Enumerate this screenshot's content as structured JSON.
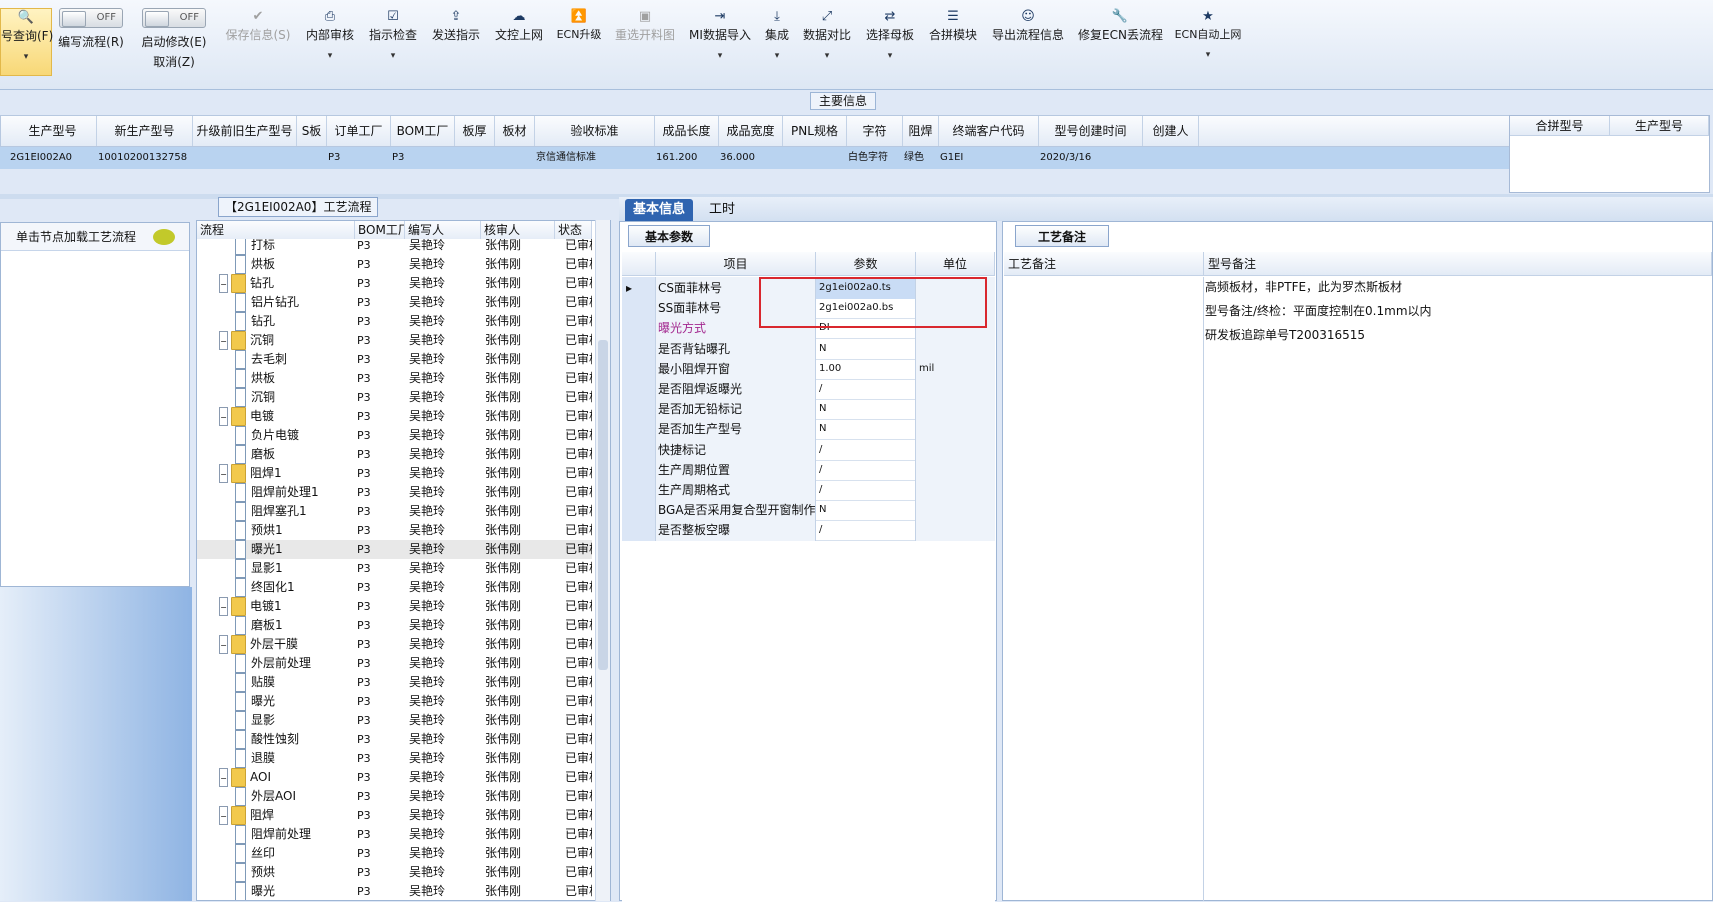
{
  "toolbar": {
    "query_label": "号查询(F)",
    "edit_flow_label": "编写流程(R)",
    "start_edit_label": "启动修改(E)",
    "cancel_label": "取消(Z)",
    "toggle_off": "OFF",
    "buttons": [
      "保存信息(S)",
      "内部审核",
      "指示检查",
      "发送指示",
      "文控上网",
      "ECN升级",
      "重选开料图",
      "MI数据导入",
      "集成",
      "数据对比",
      "选择母板",
      "合拼模块",
      "导出流程信息",
      "修复ECN丢流程",
      "ECN自动上网"
    ],
    "dropdown_glyph": "▾"
  },
  "main_info": {
    "title": "主要信息",
    "headers": [
      "生产型号",
      "新生产型号",
      "升级前旧生产型号",
      "S板",
      "订单工厂",
      "BOM工厂",
      "板厚",
      "板材",
      "验收标准",
      "成品长度",
      "成品宽度",
      "PNL规格",
      "字符",
      "阻焊",
      "终端客户代码",
      "型号创建时间",
      "创建人"
    ],
    "row": [
      "2G1EI002A0",
      "10010200132758",
      "",
      "",
      "P3",
      "P3",
      "",
      "",
      "京信通信标准",
      "161.200",
      "36.000",
      "",
      "白色字符",
      "绿色",
      "G1EI",
      "2020/3/16",
      ""
    ],
    "merge_headers": [
      "合拼型号",
      "生产型号"
    ]
  },
  "left_panel": {
    "title": "单击节点加载工艺流程"
  },
  "flow": {
    "title": "【2G1EI002A0】工艺流程",
    "headers": [
      "流程",
      "BOM工厂",
      "编写人",
      "核审人",
      "状态"
    ],
    "rows": [
      {
        "name": "打标",
        "type": "doc",
        "bom": "P3",
        "writer": "吴艳玲",
        "checker": "张伟刚",
        "status": "已审核"
      },
      {
        "name": "烘板",
        "type": "doc",
        "bom": "P3",
        "writer": "吴艳玲",
        "checker": "张伟刚",
        "status": "已审核"
      },
      {
        "name": "钻孔",
        "type": "folder",
        "bom": "P3",
        "writer": "吴艳玲",
        "checker": "张伟刚",
        "status": "已审核"
      },
      {
        "name": "铝片钻孔",
        "type": "doc",
        "bom": "P3",
        "writer": "吴艳玲",
        "checker": "张伟刚",
        "status": "已审核"
      },
      {
        "name": "钻孔",
        "type": "doc",
        "bom": "P3",
        "writer": "吴艳玲",
        "checker": "张伟刚",
        "status": "已审核"
      },
      {
        "name": "沉铜",
        "type": "folder",
        "bom": "P3",
        "writer": "吴艳玲",
        "checker": "张伟刚",
        "status": "已审核"
      },
      {
        "name": "去毛刺",
        "type": "doc",
        "bom": "P3",
        "writer": "吴艳玲",
        "checker": "张伟刚",
        "status": "已审核"
      },
      {
        "name": "烘板",
        "type": "doc",
        "bom": "P3",
        "writer": "吴艳玲",
        "checker": "张伟刚",
        "status": "已审核"
      },
      {
        "name": "沉铜",
        "type": "doc",
        "bom": "P3",
        "writer": "吴艳玲",
        "checker": "张伟刚",
        "status": "已审核"
      },
      {
        "name": "电镀",
        "type": "folder",
        "bom": "P3",
        "writer": "吴艳玲",
        "checker": "张伟刚",
        "status": "已审核"
      },
      {
        "name": "负片电镀",
        "type": "doc",
        "bom": "P3",
        "writer": "吴艳玲",
        "checker": "张伟刚",
        "status": "已审核"
      },
      {
        "name": "磨板",
        "type": "doc",
        "bom": "P3",
        "writer": "吴艳玲",
        "checker": "张伟刚",
        "status": "已审核"
      },
      {
        "name": "阻焊1",
        "type": "folder",
        "bom": "P3",
        "writer": "吴艳玲",
        "checker": "张伟刚",
        "status": "已审核"
      },
      {
        "name": "阻焊前处理1",
        "type": "doc",
        "bom": "P3",
        "writer": "吴艳玲",
        "checker": "张伟刚",
        "status": "已审核"
      },
      {
        "name": "阻焊塞孔1",
        "type": "doc",
        "bom": "P3",
        "writer": "吴艳玲",
        "checker": "张伟刚",
        "status": "已审核"
      },
      {
        "name": "预烘1",
        "type": "doc",
        "bom": "P3",
        "writer": "吴艳玲",
        "checker": "张伟刚",
        "status": "已审核"
      },
      {
        "name": "曝光1",
        "type": "doc",
        "bom": "P3",
        "writer": "吴艳玲",
        "checker": "张伟刚",
        "status": "已审核"
      },
      {
        "name": "显影1",
        "type": "doc",
        "bom": "P3",
        "writer": "吴艳玲",
        "checker": "张伟刚",
        "status": "已审核"
      },
      {
        "name": "终固化1",
        "type": "doc",
        "bom": "P3",
        "writer": "吴艳玲",
        "checker": "张伟刚",
        "status": "已审核"
      },
      {
        "name": "电镀1",
        "type": "folder",
        "bom": "P3",
        "writer": "吴艳玲",
        "checker": "张伟刚",
        "status": "已审核"
      },
      {
        "name": "磨板1",
        "type": "doc",
        "bom": "P3",
        "writer": "吴艳玲",
        "checker": "张伟刚",
        "status": "已审核"
      },
      {
        "name": "外层干膜",
        "type": "folder",
        "bom": "P3",
        "writer": "吴艳玲",
        "checker": "张伟刚",
        "status": "已审核"
      },
      {
        "name": "外层前处理",
        "type": "doc",
        "bom": "P3",
        "writer": "吴艳玲",
        "checker": "张伟刚",
        "status": "已审核"
      },
      {
        "name": "贴膜",
        "type": "doc",
        "bom": "P3",
        "writer": "吴艳玲",
        "checker": "张伟刚",
        "status": "已审核"
      },
      {
        "name": "曝光",
        "type": "doc",
        "bom": "P3",
        "writer": "吴艳玲",
        "checker": "张伟刚",
        "status": "已审核"
      },
      {
        "name": "显影",
        "type": "doc",
        "bom": "P3",
        "writer": "吴艳玲",
        "checker": "张伟刚",
        "status": "已审核"
      },
      {
        "name": "酸性蚀刻",
        "type": "doc",
        "bom": "P3",
        "writer": "吴艳玲",
        "checker": "张伟刚",
        "status": "已审核"
      },
      {
        "name": "退膜",
        "type": "doc",
        "bom": "P3",
        "writer": "吴艳玲",
        "checker": "张伟刚",
        "status": "已审核"
      },
      {
        "name": "AOI",
        "type": "folder",
        "bom": "P3",
        "writer": "吴艳玲",
        "checker": "张伟刚",
        "status": "已审核"
      },
      {
        "name": "外层AOI",
        "type": "doc",
        "bom": "P3",
        "writer": "吴艳玲",
        "checker": "张伟刚",
        "status": "已审核"
      },
      {
        "name": "阻焊",
        "type": "folder",
        "bom": "P3",
        "writer": "吴艳玲",
        "checker": "张伟刚",
        "status": "已审核"
      },
      {
        "name": "阻焊前处理",
        "type": "doc",
        "bom": "P3",
        "writer": "吴艳玲",
        "checker": "张伟刚",
        "status": "已审核"
      },
      {
        "name": "丝印",
        "type": "doc",
        "bom": "P3",
        "writer": "吴艳玲",
        "checker": "张伟刚",
        "status": "已审核"
      },
      {
        "name": "预烘",
        "type": "doc",
        "bom": "P3",
        "writer": "吴艳玲",
        "checker": "张伟刚",
        "status": "已审核"
      },
      {
        "name": "曝光",
        "type": "doc",
        "bom": "P3",
        "writer": "吴艳玲",
        "checker": "张伟刚",
        "status": "已审核"
      }
    ]
  },
  "tabs": {
    "items": [
      "基本信息",
      "工时"
    ]
  },
  "basic": {
    "title": "基本参数",
    "headers": [
      "项目",
      "参数",
      "单位"
    ],
    "rows": [
      {
        "item": "CS面菲林号",
        "value": "2g1ei002a0.ts",
        "unit": ""
      },
      {
        "item": "SS面菲林号",
        "value": "2g1ei002a0.bs",
        "unit": ""
      },
      {
        "item": "曝光方式",
        "value": "DI",
        "unit": "",
        "highlight": true
      },
      {
        "item": "是否背钻曝孔",
        "value": "N",
        "unit": ""
      },
      {
        "item": "最小阻焊开窗",
        "value": "1.00",
        "unit": "mil"
      },
      {
        "item": "是否阻焊返曝光",
        "value": "/",
        "unit": ""
      },
      {
        "item": "是否加无铅标记",
        "value": "N",
        "unit": ""
      },
      {
        "item": "是否加生产型号",
        "value": "N",
        "unit": ""
      },
      {
        "item": "快捷标记",
        "value": "/",
        "unit": ""
      },
      {
        "item": "生产周期位置",
        "value": "/",
        "unit": ""
      },
      {
        "item": "生产周期格式",
        "value": "/",
        "unit": ""
      },
      {
        "item": "BGA是否采用复合型开窗制作",
        "value": "N",
        "unit": ""
      },
      {
        "item": "是否整板空曝",
        "value": "/",
        "unit": ""
      }
    ]
  },
  "remarks": {
    "title": "工艺备注",
    "headers": [
      "工艺备注",
      "型号备注"
    ],
    "lines": [
      "高频板材，非PTFE，此为罗杰斯板材",
      "型号备注/终检：平面度控制在0.1mm以内",
      "研发板追踪单号T200316515"
    ]
  }
}
